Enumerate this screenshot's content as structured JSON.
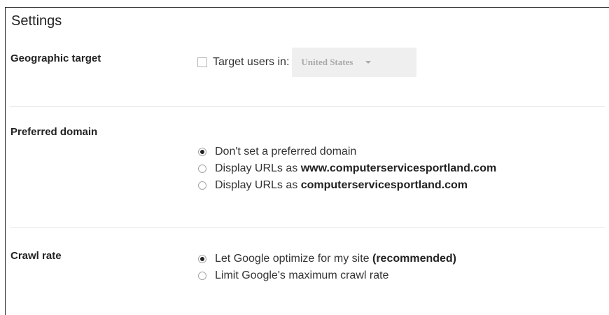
{
  "settings": {
    "title": "Settings",
    "geographic_target": {
      "label": "Geographic target",
      "checkbox_label": "Target users in:",
      "checked": false,
      "country": "United States"
    },
    "preferred_domain": {
      "label": "Preferred domain",
      "options": [
        {
          "text": "Don't set a preferred domain",
          "bold": "",
          "selected": true
        },
        {
          "text": "Display URLs as ",
          "bold": "www.computerservicesportland.com",
          "selected": false
        },
        {
          "text": "Display URLs as ",
          "bold": "computerservicesportland.com",
          "selected": false
        }
      ]
    },
    "crawl_rate": {
      "label": "Crawl rate",
      "options": [
        {
          "text": "Let Google optimize for my site ",
          "bold": "(recommended)",
          "selected": true
        },
        {
          "text": "Limit Google's maximum crawl rate",
          "bold": "",
          "selected": false
        }
      ]
    }
  }
}
